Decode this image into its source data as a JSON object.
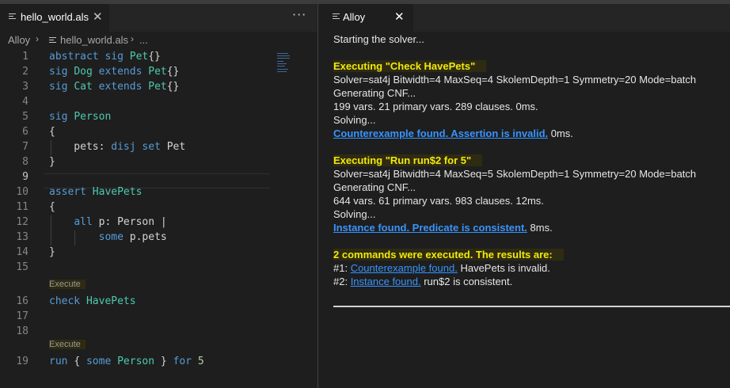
{
  "editor": {
    "tab_label": "hello_world.als",
    "close_glyph": "✕",
    "more_glyph": "···",
    "breadcrumb": {
      "root": "Alloy",
      "file": "hello_world.als",
      "tail": "..."
    },
    "lines": [
      {
        "n": "1",
        "text": "abstract sig Pet{}"
      },
      {
        "n": "2",
        "text": "sig Dog extends Pet{}"
      },
      {
        "n": "3",
        "text": "sig Cat extends Pet{}"
      },
      {
        "n": "4",
        "text": ""
      },
      {
        "n": "5",
        "text": "sig Person"
      },
      {
        "n": "6",
        "text": "{"
      },
      {
        "n": "7",
        "text": "    pets: disj set Pet"
      },
      {
        "n": "8",
        "text": "}"
      },
      {
        "n": "9",
        "text": ""
      },
      {
        "n": "10",
        "text": "assert HavePets"
      },
      {
        "n": "11",
        "text": "{"
      },
      {
        "n": "12",
        "text": "    all p: Person |"
      },
      {
        "n": "13",
        "text": "        some p.pets"
      },
      {
        "n": "14",
        "text": "}"
      },
      {
        "n": "15",
        "text": ""
      },
      {
        "n": "16",
        "text": "check HavePets"
      },
      {
        "n": "17",
        "text": ""
      },
      {
        "n": "18",
        "text": ""
      },
      {
        "n": "19",
        "text": "run { some Person } for 5"
      }
    ],
    "codelens": [
      "Execute",
      "Execute"
    ]
  },
  "output": {
    "tab_label": "Alloy",
    "close_glyph": "✕",
    "l1": "Starting the solver...",
    "c1_header": "Executing \"Check HavePets\"",
    "c1_solver": "Solver=sat4j Bitwidth=4 MaxSeq=4 SkolemDepth=1 Symmetry=20 Mode=batch",
    "c1_gen": "Generating CNF...",
    "c1_stats": "199 vars. 21 primary vars. 289 clauses. 0ms.",
    "c1_solving": "Solving...",
    "c1_link": "Counterexample found. Assertion is invalid.",
    "c1_time": " 0ms.",
    "c2_header": "Executing \"Run run$2 for 5\"",
    "c2_solver": "Solver=sat4j Bitwidth=4 MaxSeq=5 SkolemDepth=1 Symmetry=20 Mode=batch",
    "c2_gen": "Generating CNF...",
    "c2_stats": "644 vars. 61 primary vars. 983 clauses. 12ms.",
    "c2_solving": "Solving...",
    "c2_link": "Instance found. Predicate is consistent.",
    "c2_time": " 8ms.",
    "summary_header": "2 commands were executed. The results are:",
    "r1_prefix": "#1: ",
    "r1_link": "Counterexample found.",
    "r1_rest": " HavePets is invalid.",
    "r2_prefix": "#2: ",
    "r2_link": "Instance found.",
    "r2_rest": " run$2 is consistent."
  }
}
